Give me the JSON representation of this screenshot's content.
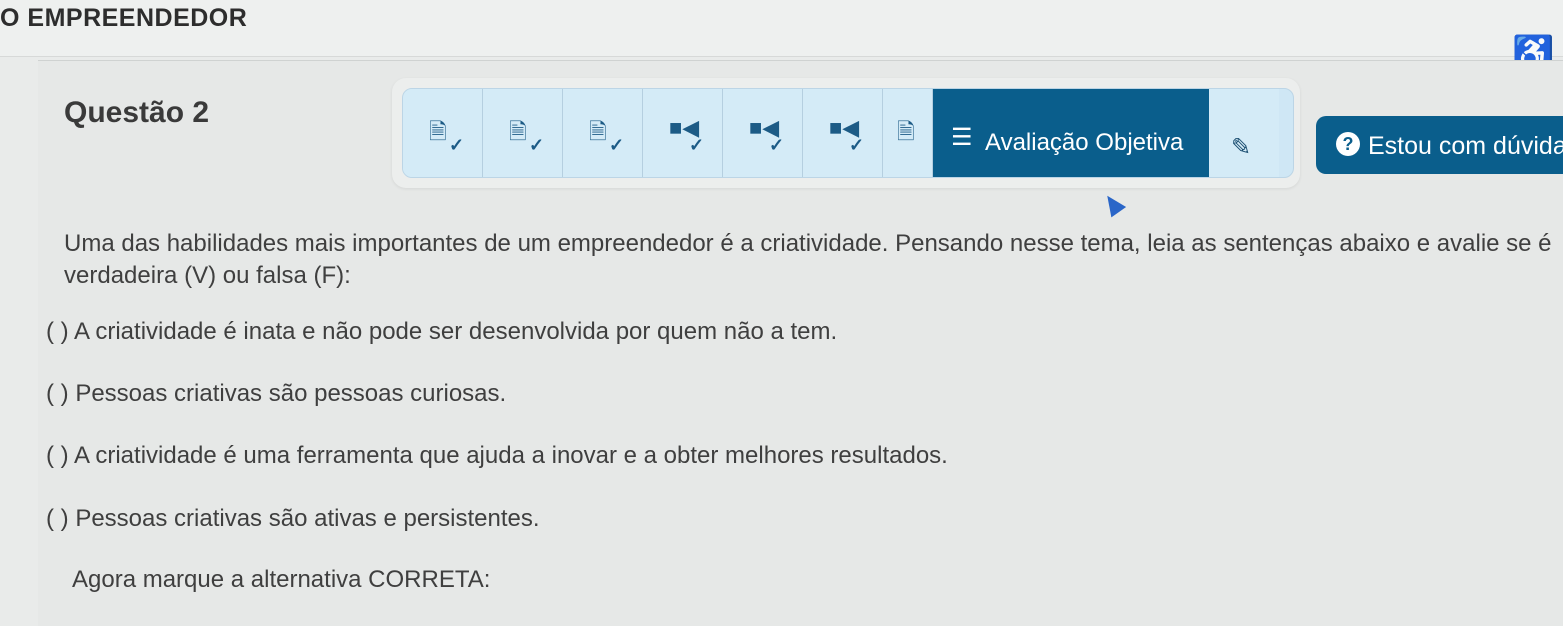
{
  "header": {
    "course_title": "O EMPREENDEDOR",
    "accessibility_icon": "accessibility-icon"
  },
  "question": {
    "title": "Questão 2"
  },
  "nav": {
    "tabs": [
      {
        "icon": "document-check-icon",
        "glyph": "🗎",
        "check": "✓"
      },
      {
        "icon": "document-check-icon",
        "glyph": "🗎",
        "check": "✓"
      },
      {
        "icon": "document-check-icon",
        "glyph": "🗎",
        "check": "✓"
      },
      {
        "icon": "video-check-icon",
        "glyph": "■◀",
        "check": "✓"
      },
      {
        "icon": "video-check-icon",
        "glyph": "■◀",
        "check": "✓"
      },
      {
        "icon": "video-check-icon",
        "glyph": "■◀",
        "check": "✓"
      },
      {
        "icon": "document-icon",
        "glyph": "🗎"
      }
    ],
    "active_tab": {
      "icon": "list-icon",
      "glyph": "☰",
      "label": "Avaliação Objetiva"
    },
    "pencil_icon": "pencil-icon",
    "pencil_glyph": "✎",
    "colors": {
      "active": "#0a5e8c",
      "tab_bg": "#d4ebf7"
    }
  },
  "help": {
    "label": "Estou com dúvida",
    "icon": "question-icon",
    "glyph": "?"
  },
  "body": {
    "statement": "Uma das habilidades mais importantes de um empreendedor é a criatividade. Pensando nesse tema, leia as sentenças abaixo e avalie se é verdadeira (V) ou falsa (F):",
    "options": [
      "(     ) A criatividade é inata e não pode ser desenvolvida por quem não a tem.",
      "(     ) Pessoas criativas são pessoas curiosas.",
      "(   ) A criatividade é uma ferramenta que ajuda a inovar e a obter melhores resultados.",
      "(     ) Pessoas criativas são ativas e persistentes."
    ],
    "instruction": "Agora marque a alternativa CORRETA:"
  }
}
